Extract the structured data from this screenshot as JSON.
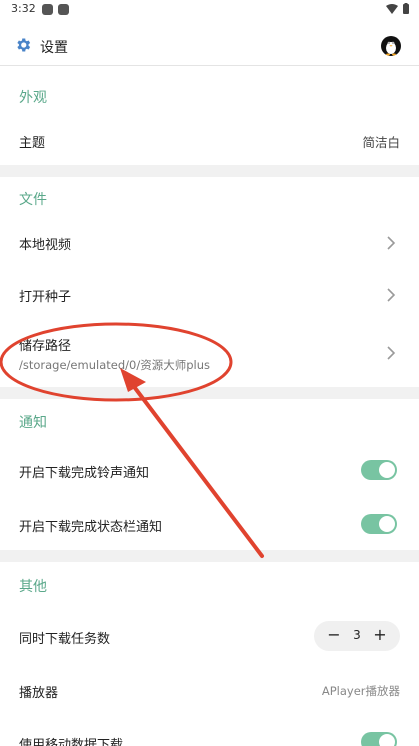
{
  "status": {
    "time": "3:32"
  },
  "header": {
    "title": "设置",
    "settings_icon": "gear-icon",
    "avatar_icon": "penguin-avatar-icon"
  },
  "sections": {
    "appearance": {
      "title": "外观",
      "theme": {
        "label": "主题",
        "value": "简洁白"
      }
    },
    "files": {
      "title": "文件",
      "local_video": {
        "label": "本地视频"
      },
      "open_torrent": {
        "label": "打开种子"
      },
      "storage_path": {
        "label": "储存路径",
        "value": "/storage/emulated/0/资源大师plus"
      }
    },
    "notifications": {
      "title": "通知",
      "ringtone": {
        "label": "开启下载完成铃声通知",
        "enabled": true
      },
      "statusbar": {
        "label": "开启下载完成状态栏通知",
        "enabled": true
      }
    },
    "other": {
      "title": "其他",
      "concurrent": {
        "label": "同时下载任务数",
        "value": "3",
        "minus": "−",
        "plus": "+"
      },
      "player": {
        "label": "播放器",
        "value": "APlayer播放器"
      },
      "mobile_data": {
        "label": "使用移动数据下载",
        "enabled": true
      }
    }
  },
  "colors": {
    "accent": "#5aa88a",
    "toggle_on": "#78c4a2",
    "annotation": "#e0432f"
  }
}
